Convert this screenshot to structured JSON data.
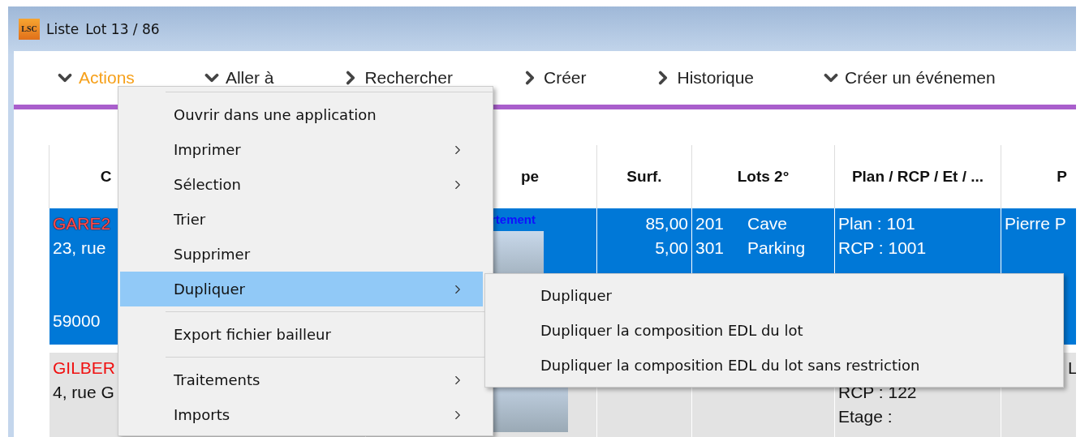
{
  "window": {
    "logo": "LSC",
    "title": "Liste",
    "subtitle": "Lot 13 / 86"
  },
  "toolbar": [
    {
      "label": "Actions",
      "expanded": true,
      "selected": true
    },
    {
      "label": "Aller à",
      "expanded": true,
      "selected": false
    },
    {
      "label": "Rechercher",
      "expanded": false,
      "selected": false
    },
    {
      "label": "Créer",
      "expanded": false,
      "selected": false
    },
    {
      "label": "Historique",
      "expanded": false,
      "selected": false
    },
    {
      "label": "Créer un événemen",
      "expanded": true,
      "selected": false
    }
  ],
  "table": {
    "columns": [
      {
        "label": "C"
      },
      {
        "label": "pe"
      },
      {
        "label": "Surf."
      },
      {
        "label": "Lots 2°"
      },
      {
        "label": "Plan / RCP / Et / ..."
      },
      {
        "label": "P"
      }
    ],
    "rows": [
      {
        "selected": true,
        "code": "GARE2",
        "address": "23, rue",
        "city": "59000",
        "type": "rtement",
        "photo": true,
        "surf": [
          "85,00",
          "5,00"
        ],
        "lots": [
          {
            "number": "201",
            "label": "Cave"
          },
          {
            "number": "301",
            "label": "Parking"
          }
        ],
        "plan": [
          "Plan : 101",
          "RCP : 1001"
        ],
        "owner": [
          "Pierre P"
        ]
      },
      {
        "selected": false,
        "code": "GILBER",
        "address": "4, rue G",
        "photo": true,
        "surf": [],
        "lots": [],
        "plan": [
          "RCP : 122",
          "Etage :"
        ],
        "owner": [
          "L"
        ]
      }
    ]
  },
  "menu": {
    "items": [
      {
        "kind": "separator"
      },
      {
        "kind": "item",
        "label": "Ouvrir dans une application",
        "submenu": false,
        "selected": false
      },
      {
        "kind": "item",
        "label": "Imprimer",
        "submenu": true,
        "selected": false
      },
      {
        "kind": "item",
        "label": "Sélection",
        "submenu": true,
        "selected": false
      },
      {
        "kind": "item",
        "label": "Trier",
        "submenu": false,
        "selected": false
      },
      {
        "kind": "item",
        "label": "Supprimer",
        "submenu": false,
        "selected": false
      },
      {
        "kind": "item",
        "label": "Dupliquer",
        "submenu": true,
        "selected": true
      },
      {
        "kind": "separator"
      },
      {
        "kind": "item",
        "label": "Export fichier bailleur",
        "submenu": false,
        "selected": false
      },
      {
        "kind": "separator"
      },
      {
        "kind": "item",
        "label": "Traitements",
        "submenu": true,
        "selected": false
      },
      {
        "kind": "item",
        "label": "Imports",
        "submenu": true,
        "selected": false
      }
    ]
  },
  "submenu": {
    "items": [
      {
        "label": "Dupliquer",
        "selected": false
      },
      {
        "label": "Dupliquer la composition EDL du lot",
        "selected": false
      },
      {
        "label": "Dupliquer la composition EDL du lot sans restriction",
        "selected": false
      }
    ]
  }
}
